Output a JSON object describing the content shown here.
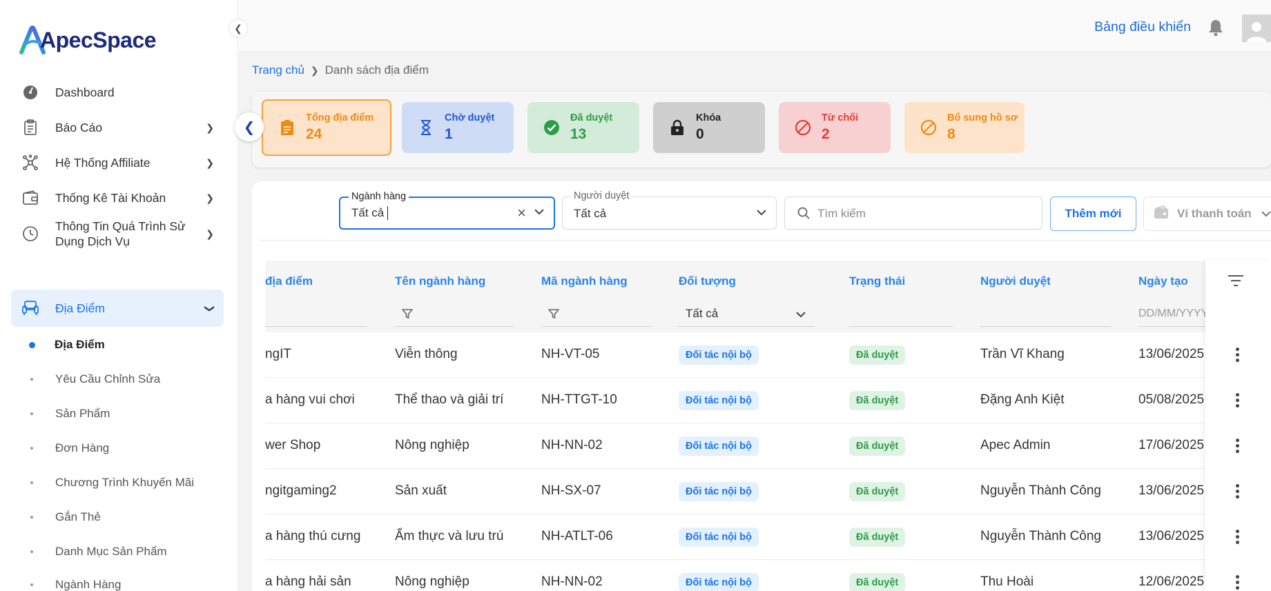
{
  "app": {
    "logo_text": "ApecSpace"
  },
  "sidebar": {
    "items": [
      {
        "label": "Dashboard",
        "icon": "gauge-icon"
      },
      {
        "label": "Báo Cáo",
        "icon": "clipboard-icon"
      },
      {
        "label": "Hệ Thống Affiliate",
        "icon": "network-icon"
      },
      {
        "label": "Thống Kê Tài Khoản",
        "icon": "wallet-icon"
      },
      {
        "label": "Thông Tin Quá Trình Sử",
        "label2": "Dụng Dịch Vụ",
        "icon": "clock-icon"
      },
      {
        "label": "Địa Điểm",
        "icon": "armchair-icon"
      }
    ],
    "sub_items": [
      "Địa Điểm",
      "Yêu Cầu Chỉnh Sửa",
      "Sản Phẩm",
      "Đơn Hàng",
      "Chương Trình Khuyến Mãi",
      "Gắn Thẻ",
      "Danh Mục Sản Phẩm",
      "Ngành Hàng"
    ]
  },
  "topbar": {
    "dashboard_link": "Bảng điều khiển"
  },
  "breadcrumb": {
    "home": "Trang chủ",
    "current": "Danh sách địa điểm"
  },
  "stats": [
    {
      "label": "Tổng địa điểm",
      "value": "24",
      "bg": "#fde3c9",
      "fg": "#f08a12",
      "border": "#f6a13a"
    },
    {
      "label": "Chờ duyệt",
      "value": "1",
      "bg": "#cfdcf6",
      "fg": "#2356d6"
    },
    {
      "label": "Đã duyệt",
      "value": "13",
      "bg": "#d3ecd9",
      "fg": "#2e9b48"
    },
    {
      "label": "Khóa",
      "value": "0",
      "bg": "#cfcfcf",
      "fg": "#222222"
    },
    {
      "label": "Từ chối",
      "value": "2",
      "bg": "#f7d1d1",
      "fg": "#e53935"
    },
    {
      "label": "Bổ sung hồ sơ",
      "value": "8",
      "bg": "#fde3c9",
      "fg": "#f08a12"
    }
  ],
  "filters": {
    "category_label": "Ngành hàng",
    "category_value": "Tất cả",
    "approver_label": "Người duyệt",
    "approver_value": "Tất cả",
    "search_placeholder": "Tìm kiếm",
    "add_button": "Thêm mới",
    "wallet_button": "Ví thanh toán"
  },
  "table": {
    "columns": [
      "địa điểm",
      "Tên ngành hàng",
      "Mã ngành hàng",
      "Đối tượng",
      "Trạng thái",
      "Người duyệt",
      "Ngày tạo"
    ],
    "target_filter": "Tất cả",
    "date_placeholder": "DD/MM/YYYY",
    "rows": [
      {
        "place": "ngIT",
        "category": "Viễn thông",
        "code": "NH-VT-05",
        "target": "Đối tác nội bộ",
        "status": "Đã duyệt",
        "approver": "Trần Vĩ Khang",
        "date": "13/06/2025"
      },
      {
        "place": "a hàng vui chơi",
        "category": "Thể thao và giải trí",
        "code": "NH-TTGT-10",
        "target": "Đối tác nội bộ",
        "status": "Đã duyệt",
        "approver": "Đặng Anh Kiệt",
        "date": "05/08/2025"
      },
      {
        "place": "wer Shop",
        "category": "Nông nghiệp",
        "code": "NH-NN-02",
        "target": "Đối tác nội bộ",
        "status": "Đã duyệt",
        "approver": "Apec Admin",
        "date": "17/06/2025"
      },
      {
        "place": "ngitgaming2",
        "category": "Sản xuất",
        "code": "NH-SX-07",
        "target": "Đối tác nội bộ",
        "status": "Đã duyệt",
        "approver": "Nguyễn Thành Công",
        "date": "13/06/2025"
      },
      {
        "place": "a hàng thú cưng",
        "category": "Ẩm thực và lưu trú",
        "code": "NH-ATLT-06",
        "target": "Đối tác nội bộ",
        "status": "Đã duyệt",
        "approver": "Nguyễn Thành Công",
        "date": "13/06/2025"
      },
      {
        "place": "a hàng hải sản",
        "category": "Nông nghiệp",
        "code": "NH-NN-02",
        "target": "Đối tác nội bộ",
        "status": "Đã duyệt",
        "approver": "Thu Hoài",
        "date": "12/06/2025"
      }
    ]
  }
}
